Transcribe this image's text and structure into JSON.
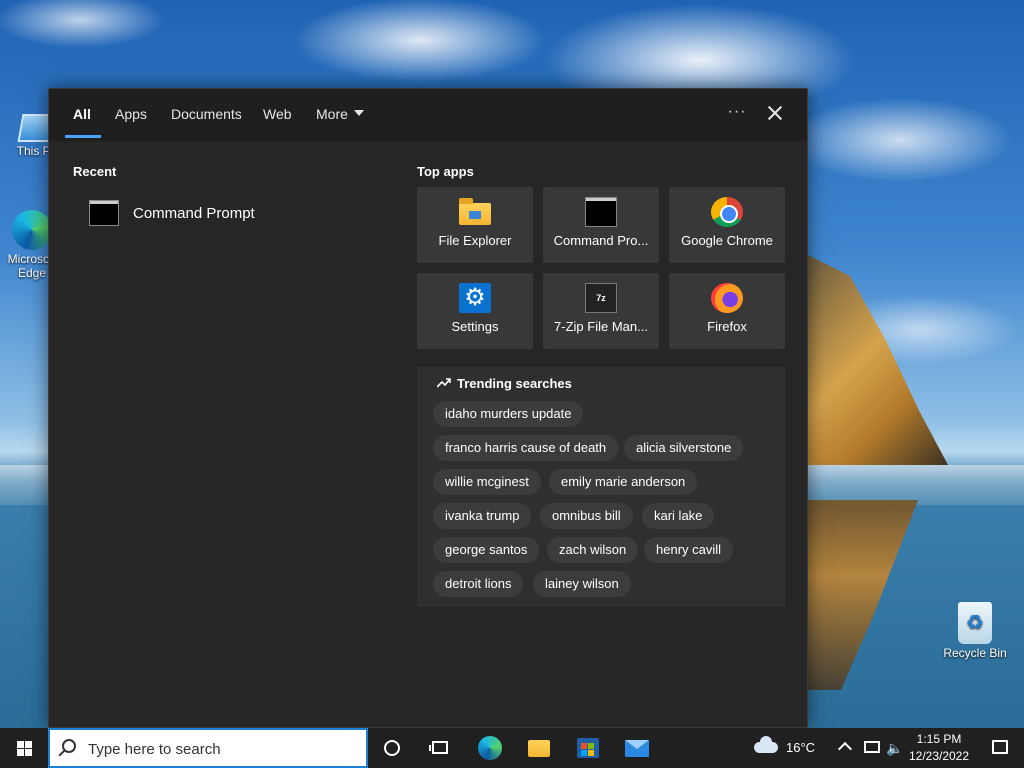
{
  "desktop": {
    "icons": [
      {
        "label": "This PC"
      },
      {
        "label": "Microsoft Edge"
      },
      {
        "label": "Recycle Bin"
      }
    ]
  },
  "search_panel": {
    "tabs": [
      {
        "label": "All",
        "active": true
      },
      {
        "label": "Apps"
      },
      {
        "label": "Documents"
      },
      {
        "label": "Web"
      },
      {
        "label": "More"
      }
    ],
    "options_label": "···",
    "recent": {
      "title": "Recent",
      "items": [
        {
          "label": "Command Prompt",
          "icon": "command-prompt-icon"
        }
      ]
    },
    "top_apps": {
      "title": "Top apps",
      "items": [
        {
          "label": "File Explorer",
          "icon": "file-explorer-icon"
        },
        {
          "label": "Command Pro...",
          "icon": "command-prompt-icon"
        },
        {
          "label": "Google Chrome",
          "icon": "chrome-icon"
        },
        {
          "label": "Settings",
          "icon": "settings-icon"
        },
        {
          "label": "7-Zip File Man...",
          "icon": "7zip-icon",
          "glyph_text": "7z"
        },
        {
          "label": "Firefox",
          "icon": "firefox-icon"
        }
      ]
    },
    "trending": {
      "title": "Trending searches",
      "items": [
        "idaho murders update",
        "franco harris cause of death",
        "alicia silverstone",
        "willie mcginest",
        "emily marie anderson",
        "ivanka trump",
        "omnibus bill",
        "kari lake",
        "george santos",
        "zach wilson",
        "henry cavill",
        "detroit lions",
        "lainey wilson"
      ]
    }
  },
  "taskbar": {
    "search_placeholder": "Type here to search",
    "weather": {
      "temp": "16°C",
      "icon": "cloud-icon"
    },
    "clock": {
      "time": "1:15 PM",
      "date": "12/23/2022"
    },
    "accent_color": "#1c7fd8"
  }
}
